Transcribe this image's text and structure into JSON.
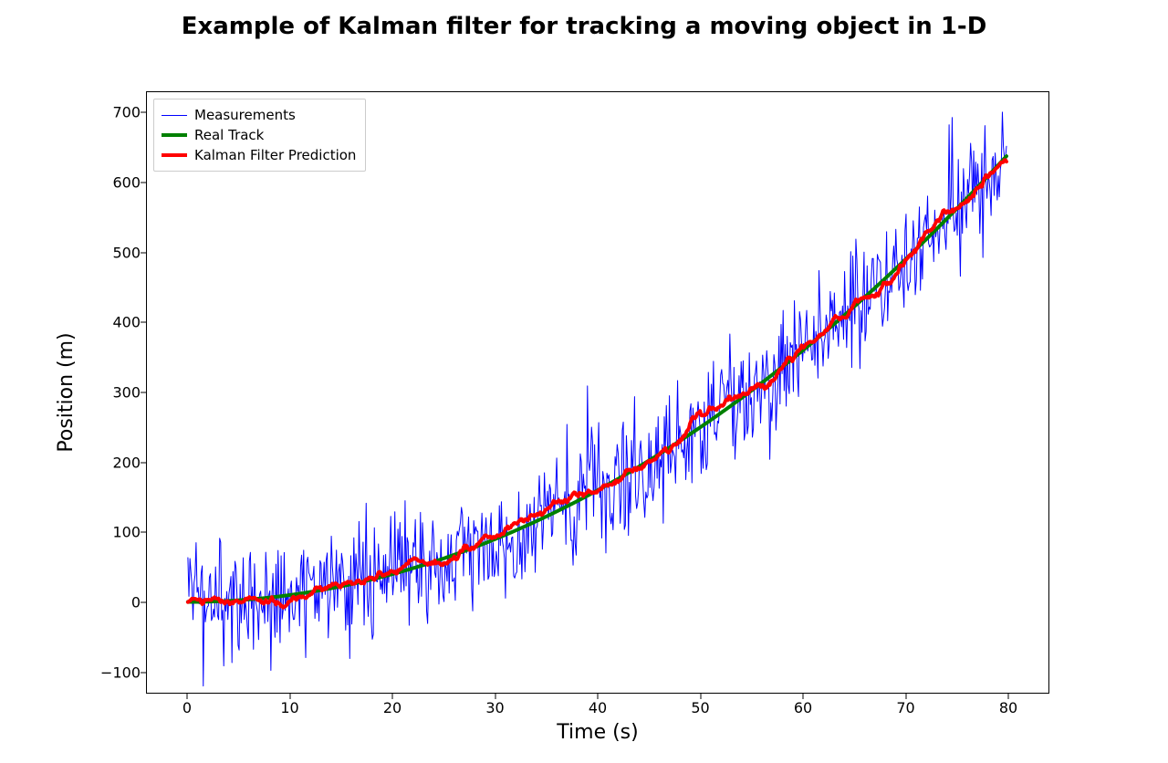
{
  "chart_data": {
    "type": "line",
    "title": "Example of Kalman filter for tracking a moving object in 1-D",
    "xlabel": "Time (s)",
    "ylabel": "Position (m)",
    "xlim": [
      -4,
      84
    ],
    "ylim": [
      -130,
      730
    ],
    "xticks": [
      0,
      10,
      20,
      30,
      40,
      50,
      60,
      70,
      80
    ],
    "yticks": [
      -100,
      0,
      100,
      200,
      300,
      400,
      500,
      600,
      700
    ],
    "x_step": 0.1,
    "n_points": 800,
    "series": [
      {
        "name": "Measurements",
        "color": "#0000ff",
        "width": 1,
        "legend_label": "Measurements",
        "model": "measurements",
        "noise_std": 45
      },
      {
        "name": "Real Track",
        "color": "#008000",
        "width": 4,
        "legend_label": "Real Track",
        "model": "real",
        "formula": "0.1 * t^2",
        "sample_points": [
          {
            "t": 0,
            "y": 0
          },
          {
            "t": 10,
            "y": 10
          },
          {
            "t": 20,
            "y": 40
          },
          {
            "t": 30,
            "y": 90
          },
          {
            "t": 40,
            "y": 160
          },
          {
            "t": 50,
            "y": 250
          },
          {
            "t": 60,
            "y": 360
          },
          {
            "t": 70,
            "y": 490
          },
          {
            "t": 80,
            "y": 640
          }
        ]
      },
      {
        "name": "Kalman Filter Prediction",
        "color": "#ff0000",
        "width": 4,
        "legend_label": "Kalman Filter Prediction",
        "model": "kalman",
        "wobble_std": 8
      }
    ]
  }
}
